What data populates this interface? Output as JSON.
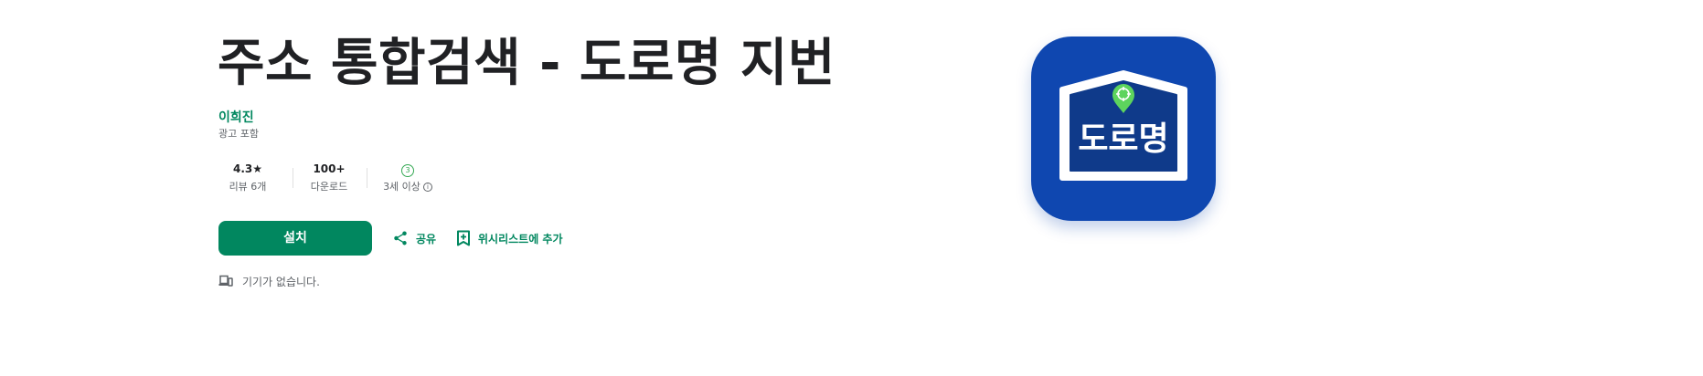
{
  "app": {
    "title": "주소 통합검색 - 도로명 지번",
    "developer": "이희진",
    "ads_notice": "광고 포함",
    "icon_text": "도로명"
  },
  "stats": {
    "rating": {
      "value": "4.3★",
      "label": "리뷰 6개"
    },
    "downloads": {
      "value": "100+",
      "label": "다운로드"
    },
    "age": {
      "badge": "3",
      "label": "3세 이상"
    }
  },
  "actions": {
    "install_label": "설치",
    "share_label": "공유",
    "wishlist_label": "위시리스트에 추가"
  },
  "device_notice": "기기가 없습니다.",
  "colors": {
    "accent": "#01875f",
    "icon_background": "#0f47b0",
    "pin": "#5dd45d"
  },
  "icons": [
    "share-icon",
    "bookmark-add-icon",
    "devices-icon",
    "info-icon",
    "location-pin-icon"
  ]
}
